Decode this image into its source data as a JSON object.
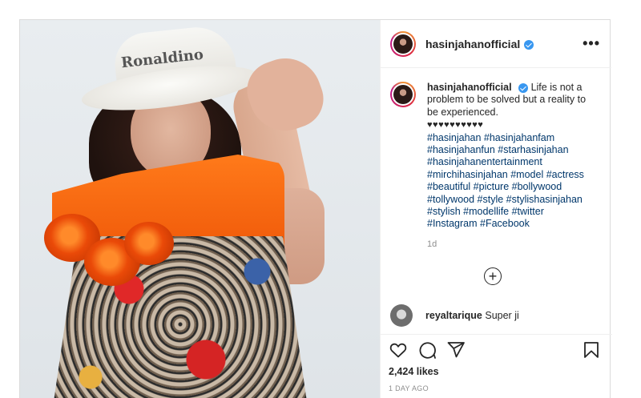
{
  "post": {
    "photo": {
      "hat_text": "Ronaldino",
      "alt": "Photo by hasinjahanofficial"
    },
    "header": {
      "username": "hasinjahanofficial",
      "verified": true,
      "more_label": "•••"
    },
    "caption": {
      "username": "hasinjahanofficial",
      "text": "Life is not a problem to be solved but a reality to be experienced.",
      "hearts": "♥♥♥♥♥♥♥♥♥♥",
      "hashtags": "#hasinjahan #hasinjahanfam #hasinjahanfun #starhasinjahan #hasinjahanentertainment #mirchihasinjahan #model #actress #beautiful #picture #bollywood #tollywood #style #stylishasinjahan #stylish #modellife #twitter #Instagram #Facebook",
      "age": "1d"
    },
    "load_more_label": "+",
    "comments": [
      {
        "username": "reyaltarique",
        "text": "Super ji"
      }
    ],
    "actions": {
      "like_icon": "heart-icon",
      "comment_icon": "comment-icon",
      "share_icon": "share-icon",
      "save_icon": "bookmark-icon"
    },
    "likes": "2,424 likes",
    "timestamp": "1 DAY AGO"
  },
  "colors": {
    "verified": "#3897f0",
    "hashtag": "#00376b",
    "muted": "#8e8e8e",
    "border": "#dbdbdb"
  }
}
